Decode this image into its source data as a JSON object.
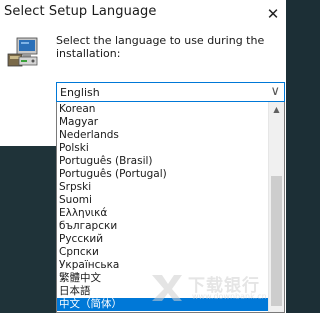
{
  "window": {
    "title": "Select Setup Language",
    "close_glyph": "✕"
  },
  "prompt": {
    "text": "Select the language to use during the installation:"
  },
  "language_select": {
    "value": "English",
    "arrow_glyph": "∨"
  },
  "language_list": {
    "items": [
      "Korean",
      "Magyar",
      "Nederlands",
      "Polski",
      "Português (Brasil)",
      "Português (Portugal)",
      "Srpski",
      "Suomi",
      "Ελληνικά",
      "български",
      "Русский",
      "Српски",
      "Українська",
      "繁體中文",
      "日本語",
      "中文（简体）"
    ],
    "selected": "中文（简体）"
  },
  "scrollbar": {
    "up_glyph": "▲"
  },
  "watermark": {
    "text": "下载银行",
    "sub": "www.downbank.cn"
  },
  "colors": {
    "accent": "#0078d7",
    "backdrop": "#1f3339"
  }
}
